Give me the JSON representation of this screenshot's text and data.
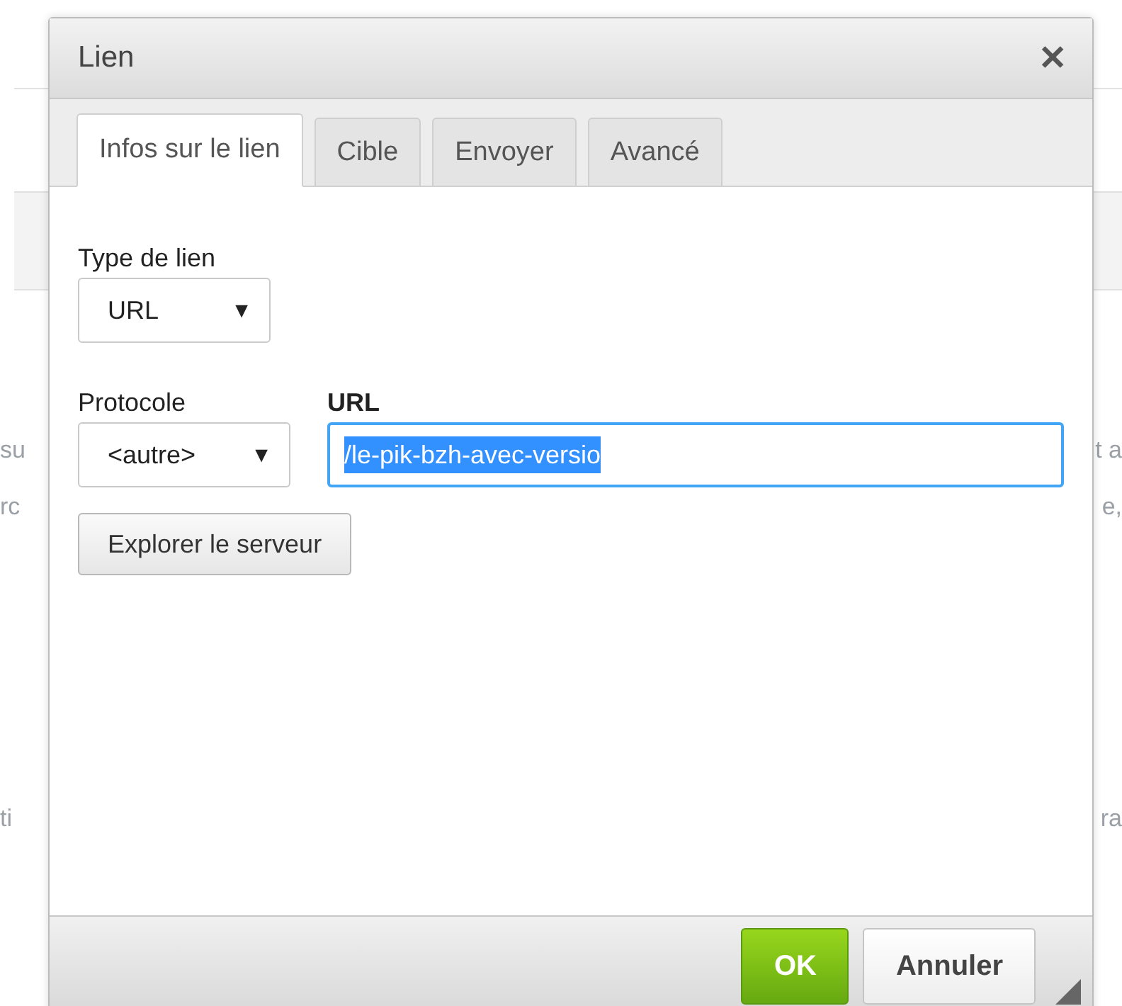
{
  "background": {
    "rows": [
      {
        "left": "su",
        "right": "t a"
      },
      {
        "left": "rc",
        "right": "e,"
      },
      {
        "left": "ti",
        "right": "ra"
      }
    ]
  },
  "dialog": {
    "title": "Lien",
    "close": "✕",
    "tabs": [
      {
        "label": "Infos sur le lien",
        "selected": true
      },
      {
        "label": "Cible",
        "selected": false
      },
      {
        "label": "Envoyer",
        "selected": false
      },
      {
        "label": "Avancé",
        "selected": false
      }
    ],
    "link_type": {
      "label": "Type de lien",
      "value": "URL",
      "arrow": "▼"
    },
    "protocol": {
      "label": "Protocole",
      "value": "<autre>",
      "arrow": "▼"
    },
    "url": {
      "label": "URL",
      "value": "/le-pik-bzh-avec-versio",
      "text_selected": true,
      "focused": true
    },
    "browse_button": "Explorer le serveur",
    "buttons": [
      {
        "label": "OK",
        "kind": "primary"
      },
      {
        "label": "Annuler",
        "kind": "secondary"
      }
    ]
  }
}
